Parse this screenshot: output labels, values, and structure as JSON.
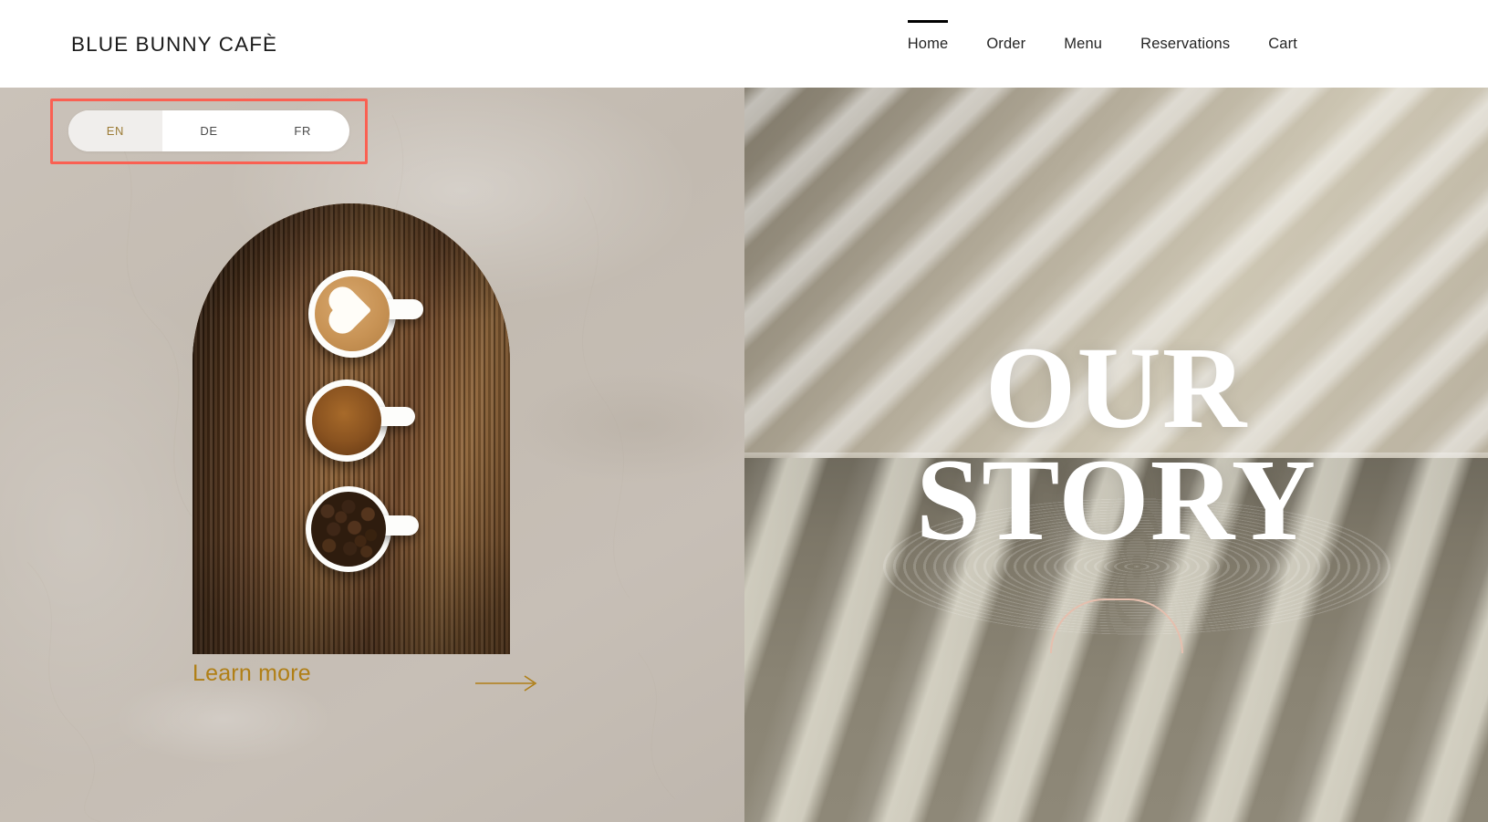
{
  "header": {
    "brand": "BLUE BUNNY CAFÈ",
    "nav": [
      {
        "label": "Home",
        "active": true
      },
      {
        "label": "Order",
        "active": false
      },
      {
        "label": "Menu",
        "active": false
      },
      {
        "label": "Reservations",
        "active": false
      },
      {
        "label": "Cart",
        "active": false
      }
    ]
  },
  "language_switcher": {
    "options": [
      {
        "code": "EN",
        "label": "EN",
        "active": true
      },
      {
        "code": "DE",
        "label": "DE",
        "active": false
      },
      {
        "code": "FR",
        "label": "FR",
        "active": false
      }
    ],
    "selected": "EN",
    "active_text_color": "#9c7c36",
    "active_bg_color": "#f0eeec",
    "pill_bg_color": "#ffffff",
    "annotation_color": "#fa6052"
  },
  "left_panel": {
    "background_color": "#c3bbb2",
    "image": {
      "alt": "Three white cups on a dark wooden board: latte with heart art, espresso, and roasted coffee beans",
      "shape": "arch"
    },
    "cta": {
      "label": "Learn more",
      "color": "#b07f16",
      "arrow_icon": "long-arrow-right-icon"
    }
  },
  "right_panel": {
    "title_lines": [
      "OUR",
      "STORY"
    ],
    "title_color": "#ffffff",
    "background_alt": "Sunlit wall with diagonal blind shadows and a textured floor",
    "decor": {
      "shape": "arch-outline",
      "color": "#e6bfae"
    }
  }
}
